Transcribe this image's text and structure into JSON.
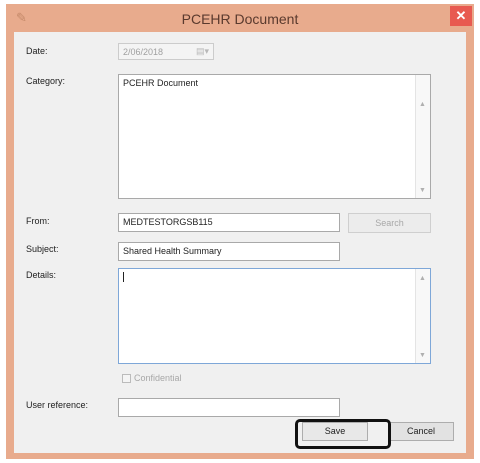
{
  "window": {
    "title": "PCEHR Document",
    "close_icon": "close-icon",
    "app_icon": "document-icon"
  },
  "fields": {
    "date": {
      "label": "Date:",
      "value": "2/06/2018",
      "dropdown_icon": "calendar-dropdown-icon"
    },
    "category": {
      "label": "Category:",
      "value": "PCEHR Document"
    },
    "from": {
      "label": "From:",
      "value": "MEDTESTORGSB115"
    },
    "search_button": "Search",
    "subject": {
      "label": "Subject:",
      "value": "Shared Health Summary"
    },
    "details": {
      "label": "Details:",
      "value": ""
    },
    "confidential": {
      "label": "Confidential",
      "checked": false
    },
    "user_reference": {
      "label": "User reference:",
      "value": ""
    }
  },
  "buttons": {
    "save": "Save",
    "cancel": "Cancel"
  },
  "colors": {
    "title_bar": "#e8ab8d",
    "close_button": "#e85a50",
    "dialog_bg": "#f0f0f0",
    "highlight": "#111111"
  }
}
